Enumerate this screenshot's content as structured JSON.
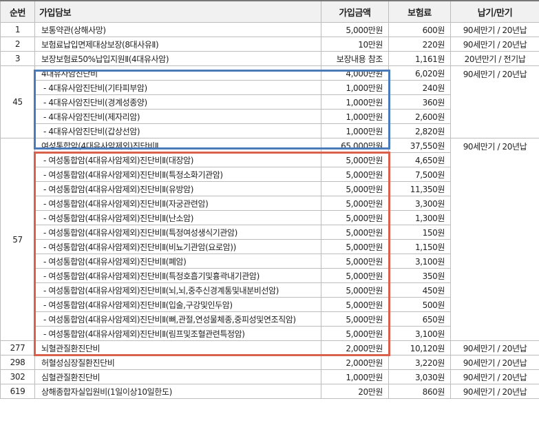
{
  "header": {
    "no": "순번",
    "name": "가입담보",
    "amount": "가입금액",
    "premium": "보험료",
    "term": "납기/만기"
  },
  "rows": [
    {
      "no": "1",
      "name": "보통약관(상해사망)",
      "amount": "5,000만원",
      "premium": "600원",
      "term": "90세만기 / 20년납"
    },
    {
      "no": "2",
      "name": "보험료납입면제대상보장(8대사유Ⅱ)",
      "amount": "10만원",
      "premium": "220원",
      "term": "90세만기 / 20년납"
    },
    {
      "no": "3",
      "name": "보장보험료50%납입지원Ⅱ(4대유사암)",
      "amount": "보장내용 참조",
      "premium": "1,161원",
      "term": "20년만기 / 전기납"
    }
  ],
  "group45": {
    "no": "45",
    "term": "90세만기 / 20년납",
    "items": [
      {
        "name": "4대유사암진단비",
        "amount": "4,000만원",
        "premium": "6,020원"
      },
      {
        "name": "- 4대유사암진단비(기타피부암)",
        "amount": "1,000만원",
        "premium": "240원"
      },
      {
        "name": "- 4대유사암진단비(경계성종양)",
        "amount": "1,000만원",
        "premium": "360원"
      },
      {
        "name": "- 4대유사암진단비(제자리암)",
        "amount": "1,000만원",
        "premium": "2,600원"
      },
      {
        "name": "- 4대유사암진단비(갑상선암)",
        "amount": "1,000만원",
        "premium": "2,820원"
      }
    ]
  },
  "group57": {
    "no": "57",
    "term": "90세만기 / 20년납",
    "items": [
      {
        "name": "여성통합암(4대유사암제외)진단비Ⅱ",
        "amount": "65,000만원",
        "premium": "37,550원"
      },
      {
        "name": "- 여성통합암(4대유사암제외)진단비Ⅱ(대장암)",
        "amount": "5,000만원",
        "premium": "4,650원"
      },
      {
        "name": "- 여성통합암(4대유사암제외)진단비Ⅱ(특정소화기관암)",
        "amount": "5,000만원",
        "premium": "7,500원"
      },
      {
        "name": "- 여성통합암(4대유사암제외)진단비Ⅱ(유방암)",
        "amount": "5,000만원",
        "premium": "11,350원"
      },
      {
        "name": "- 여성통합암(4대유사암제외)진단비Ⅱ(자궁관련암)",
        "amount": "5,000만원",
        "premium": "3,300원"
      },
      {
        "name": "- 여성통합암(4대유사암제외)진단비Ⅱ(난소암)",
        "amount": "5,000만원",
        "premium": "1,300원"
      },
      {
        "name": "- 여성통합암(4대유사암제외)진단비Ⅱ(특정여성생식기관암)",
        "amount": "5,000만원",
        "premium": "150원"
      },
      {
        "name": "- 여성통합암(4대유사암제외)진단비Ⅱ(비뇨기관암(요로암))",
        "amount": "5,000만원",
        "premium": "1,150원"
      },
      {
        "name": "- 여성통합암(4대유사암제외)진단비Ⅱ(폐암)",
        "amount": "5,000만원",
        "premium": "3,100원"
      },
      {
        "name": "- 여성통합암(4대유사암제외)진단비Ⅱ(특정호흡기및흉곽내기관암)",
        "amount": "5,000만원",
        "premium": "350원"
      },
      {
        "name": "- 여성통합암(4대유사암제외)진단비Ⅱ(뇌,뇌,중추신경계통및내분비선암)",
        "amount": "5,000만원",
        "premium": "450원"
      },
      {
        "name": "- 여성통합암(4대유사암제외)진단비Ⅱ(입술,구강및인두암)",
        "amount": "5,000만원",
        "premium": "500원"
      },
      {
        "name": "- 여성통합암(4대유사암제외)진단비Ⅱ(뼈,관절,연성물체종,중피성및연조직암)",
        "amount": "5,000만원",
        "premium": "650원"
      },
      {
        "name": "- 여성통합암(4대유사암제외)진단비Ⅱ(림프및조혈관련특정암)",
        "amount": "5,000만원",
        "premium": "3,100원"
      }
    ]
  },
  "tail_rows": [
    {
      "no": "277",
      "name": "뇌혈관질환진단비",
      "amount": "2,000만원",
      "premium": "10,120원",
      "term": "90세만기 / 20년납"
    },
    {
      "no": "298",
      "name": "허혈성심장질환진단비",
      "amount": "2,000만원",
      "premium": "3,220원",
      "term": "90세만기 / 20년납"
    },
    {
      "no": "302",
      "name": "심혈관질환진단비",
      "amount": "1,000만원",
      "premium": "3,030원",
      "term": "90세만기 / 20년납"
    },
    {
      "no": "619",
      "name": "상해종합자실입원비(1일이상10일한도)",
      "amount": "20만원",
      "premium": "860원",
      "term": "90세만기 / 20년납"
    }
  ],
  "colors": {
    "highlight_blue": "#4a7ab8",
    "highlight_red": "#d9604a",
    "header_bg": "#f1f1f1"
  }
}
